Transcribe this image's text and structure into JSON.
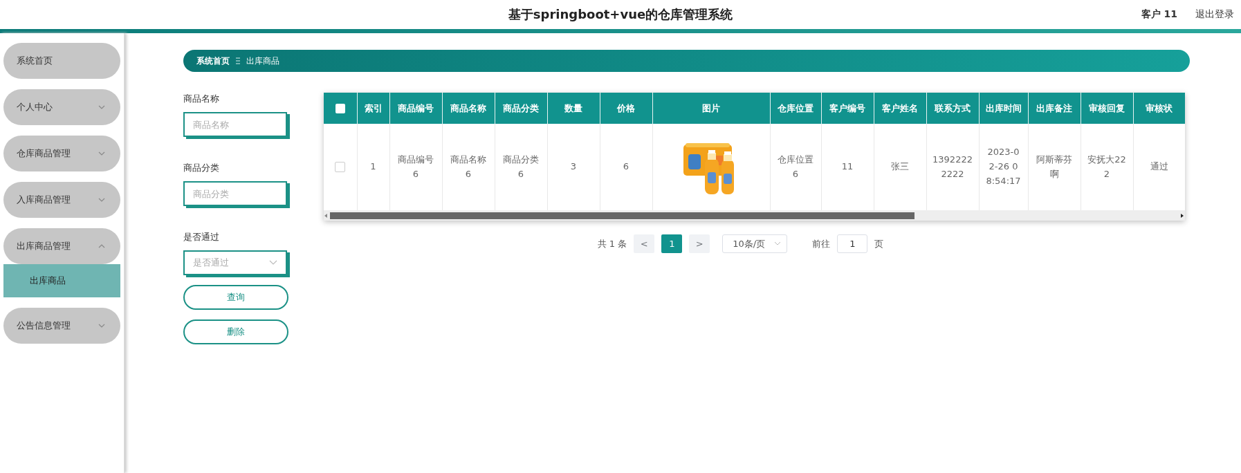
{
  "header": {
    "title": "基于springboot+vue的仓库管理系统",
    "user": "客户 11",
    "logout": "退出登录"
  },
  "sidebar": {
    "items": [
      {
        "label": "系统首页",
        "kind": "link"
      },
      {
        "label": "个人中心",
        "kind": "menu",
        "expanded": false
      },
      {
        "label": "仓库商品管理",
        "kind": "menu",
        "expanded": false
      },
      {
        "label": "入库商品管理",
        "kind": "menu",
        "expanded": false
      },
      {
        "label": "出库商品管理",
        "kind": "menu",
        "expanded": true,
        "children": [
          {
            "label": "出库商品",
            "selected": true
          }
        ]
      },
      {
        "label": "公告信息管理",
        "kind": "menu",
        "expanded": false
      }
    ]
  },
  "breadcrumb": [
    "系统首页",
    "出库商品"
  ],
  "search_form": {
    "fields": [
      {
        "label": "商品名称",
        "kind": "text",
        "placeholder": "商品名称"
      },
      {
        "label": "商品分类",
        "kind": "text",
        "placeholder": "商品分类"
      },
      {
        "label": "是否通过",
        "kind": "select",
        "placeholder": "是否通过"
      }
    ],
    "buttons": [
      "查询",
      "删除"
    ]
  },
  "table": {
    "select_all_checked": false,
    "columns": [
      "索引",
      "商品编号",
      "商品名称",
      "商品分类",
      "数量",
      "价格",
      "图片",
      "仓库位置",
      "客户编号",
      "客户姓名",
      "联系方式",
      "出库时间",
      "出库备注",
      "审核回复",
      "审核状"
    ],
    "rows": [
      {
        "checked": false,
        "cells": [
          "1",
          "商品编号6",
          "商品名称6",
          "商品分类6",
          "3",
          "6",
          {
            "kind": "picture"
          },
          "仓库位置6",
          "11",
          "张三",
          "13922222222",
          "2023-02-26 08:54:17",
          "阿斯蒂芬啊",
          "安抚大222",
          "通过"
        ]
      }
    ]
  },
  "pagination": {
    "total": "共 1 条",
    "prev": {
      "label": "<",
      "disabled": true
    },
    "pages": [
      {
        "label": "1",
        "selected": true
      }
    ],
    "next": {
      "label": ">",
      "disabled": true
    },
    "page_size": "10条/页",
    "goto_label": "前往",
    "goto_value": "1",
    "goto_unit": "页"
  }
}
